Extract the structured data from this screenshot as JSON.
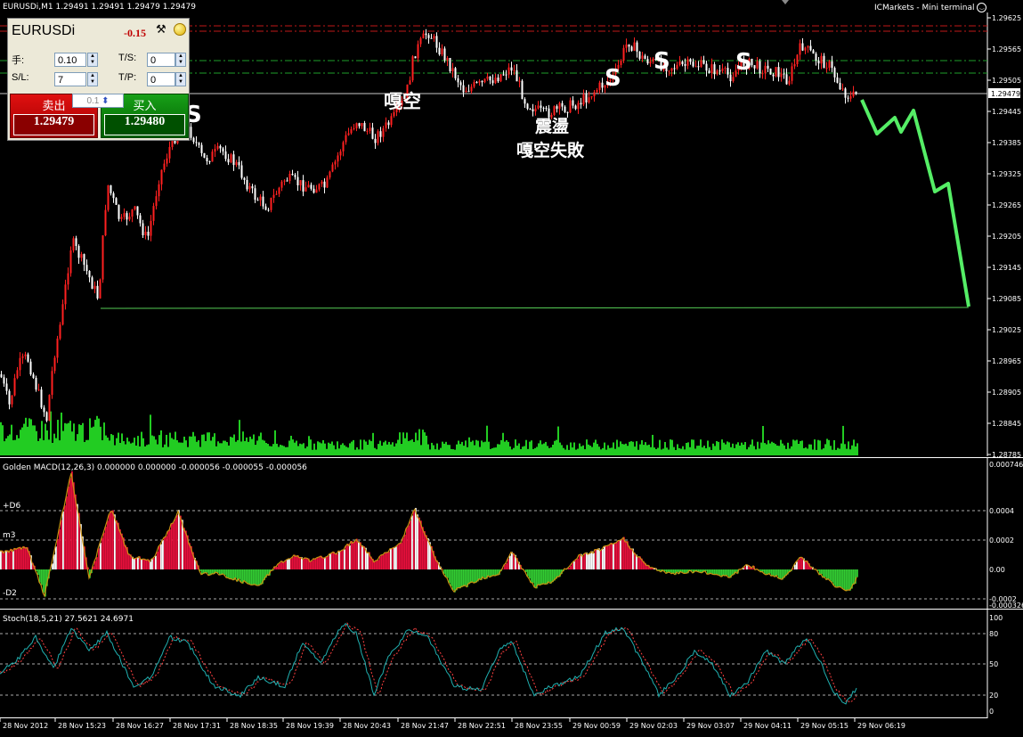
{
  "window": {
    "symbol_info": "EURUSDi,M1  1.29491 1.29491 1.29479 1.29479",
    "broker_title": "ICMarkets - Mini terminal"
  },
  "mini_terminal": {
    "symbol": "EURUSDi",
    "pl": "-0.15",
    "lots_label": "手:",
    "lots_value": "0.10",
    "ts_label": "T/S:",
    "ts_value": "0",
    "sl_label": "S/L:",
    "sl_value": "7",
    "tp_label": "T/P:",
    "tp_value": "0",
    "lot_step": "0.1",
    "sell_label": "卖出",
    "sell_price": "1.29479",
    "buy_label": "买入",
    "buy_price": "1.29480"
  },
  "annotations": {
    "s_marks": [
      "S",
      "S",
      "S",
      "S"
    ],
    "short1": "嘎空",
    "zone": "震盪",
    "short_fail": "嘎空失敗"
  },
  "price_axis": [
    "1.29625",
    "1.29565",
    "1.29505",
    "1.29479",
    "1.29445",
    "1.29385",
    "1.29325",
    "1.29265",
    "1.29205",
    "1.29145",
    "1.29085",
    "1.29025",
    "1.28965",
    "1.28905",
    "1.28845",
    "1.28785"
  ],
  "macd": {
    "title": "Golden MACD(12,26,3) 0.000000 0.000000 -0.000056 -0.000055 -0.000056",
    "axis": [
      "0.000746",
      "0.0004",
      "0.0002",
      "0.00",
      "-0.0002",
      "-0.000326"
    ],
    "level_labels": [
      "+D6",
      "m3",
      "-D2"
    ]
  },
  "stoch": {
    "title": "Stoch(18,5,21) 27.5621 24.6971",
    "axis": [
      "100",
      "80",
      "50",
      "20",
      "0"
    ]
  },
  "time_axis": [
    "28 Nov 2012",
    "28 Nov 15:23",
    "28 Nov 16:27",
    "28 Nov 17:31",
    "28 Nov 18:35",
    "28 Nov 19:39",
    "28 Nov 20:43",
    "28 Nov 21:47",
    "28 Nov 22:51",
    "28 Nov 23:55",
    "29 Nov 00:59",
    "29 Nov 02:03",
    "29 Nov 03:07",
    "29 Nov 04:11",
    "29 Nov 05:15",
    "29 Nov 06:19"
  ],
  "colors": {
    "bull": "#ff2020",
    "bear": "#ffffff",
    "volume": "#22cc22",
    "forecast": "#55ee66",
    "macd_pos": "#e8103c",
    "macd_neg": "#33cc33",
    "stoch_main": "#20b0b0",
    "stoch_signal": "#ff4040"
  }
}
